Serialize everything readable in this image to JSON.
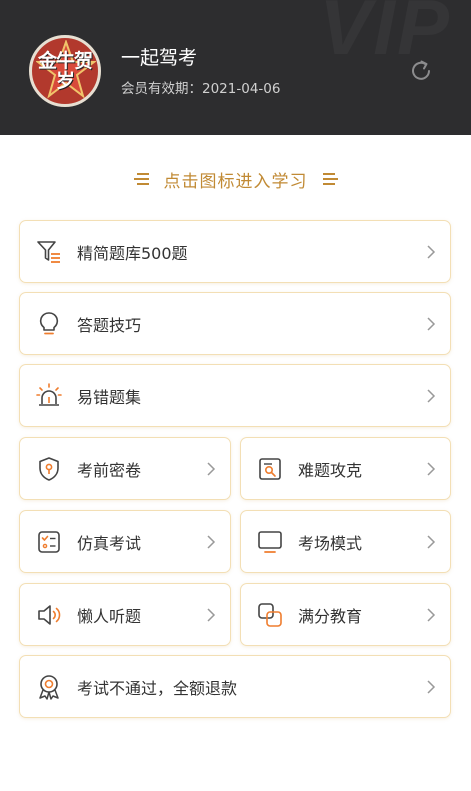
{
  "header": {
    "username": "一起驾考",
    "expiry": "会员有效期：2021-04-06",
    "watermark": "VIP",
    "avatar_text": "金牛贺岁"
  },
  "section_title": "点击图标进入学习",
  "menu": {
    "item_0": {
      "label": "精简题库500题",
      "icon": "funnel-list-icon"
    },
    "item_1": {
      "label": "答题技巧",
      "icon": "lightbulb-icon"
    },
    "item_2": {
      "label": "易错题集",
      "icon": "alarm-light-icon"
    },
    "item_3": {
      "label": "考前密卷",
      "icon": "shield-key-icon"
    },
    "item_4": {
      "label": "难题攻克",
      "icon": "search-doc-icon"
    },
    "item_5": {
      "label": "仿真考试",
      "icon": "checklist-icon"
    },
    "item_6": {
      "label": "考场模式",
      "icon": "monitor-icon"
    },
    "item_7": {
      "label": "懒人听题",
      "icon": "speaker-icon"
    },
    "item_8": {
      "label": "满分教育",
      "icon": "overlap-squares-icon"
    },
    "item_9": {
      "label": "考试不通过，全额退款",
      "icon": "award-badge-icon"
    }
  },
  "colors": {
    "header_bg": "#2d2d2f",
    "accent": "#c18a34",
    "icon_orange": "#ef7d2e",
    "card_border": "#f3dfb5"
  }
}
